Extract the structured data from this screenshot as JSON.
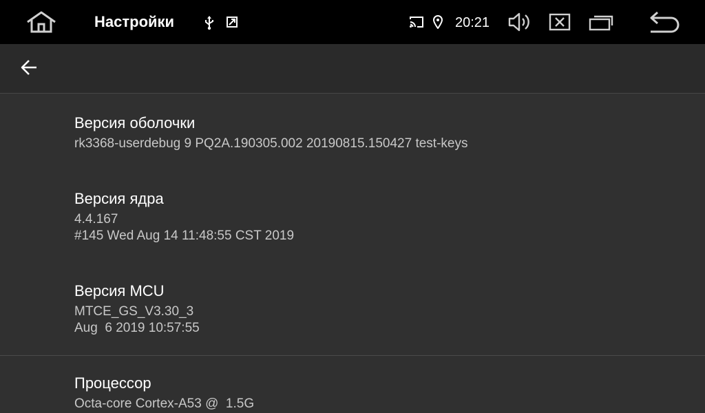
{
  "status_bar": {
    "title": "Настройки",
    "clock": "20:21",
    "icons": {
      "home": "home-icon",
      "usb": "usb-icon",
      "screenshot": "screenshot-icon",
      "cast": "cast-icon",
      "location": "location-icon",
      "volume": "volume-icon",
      "close": "close-box-icon",
      "recents": "recents-icon",
      "back": "return-icon"
    }
  },
  "app_bar": {
    "back_icon": "arrow-back-icon"
  },
  "items": [
    {
      "title": "Версия оболочки",
      "lines": [
        "rk3368-userdebug 9 PQ2A.190305.002 20190815.150427 test-keys"
      ]
    },
    {
      "title": "Версия ядра",
      "lines": [
        "4.4.167",
        "#145 Wed Aug 14 11:48:55 CST 2019"
      ]
    },
    {
      "title": "Версия MCU",
      "lines": [
        "MTCE_GS_V3.30_3",
        "Aug  6 2019 10:57:55"
      ]
    },
    {
      "title": "Процессор",
      "lines": [
        "Octa-core Cortex-A53 @  1.5G"
      ]
    }
  ]
}
